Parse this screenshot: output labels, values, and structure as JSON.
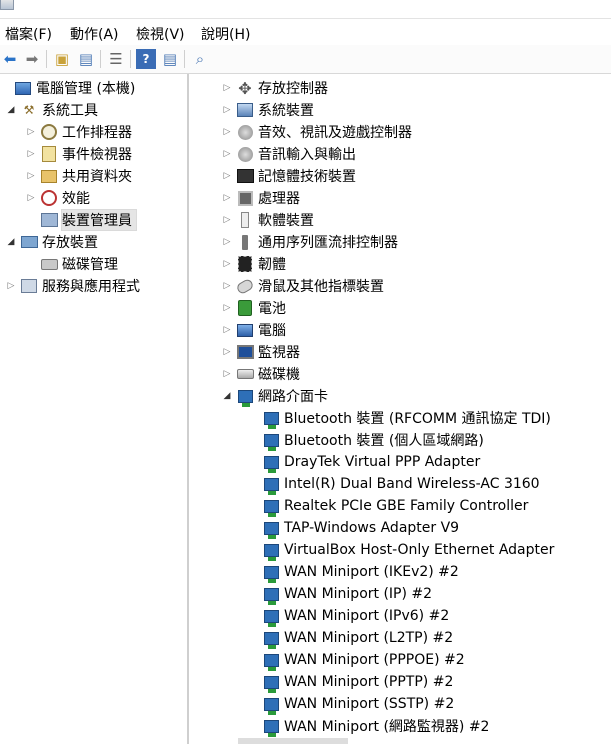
{
  "menu": [
    "檔案(F)",
    "動作(A)",
    "檢視(V)",
    "說明(H)"
  ],
  "toolbar": [
    "back-icon",
    "forward-icon",
    "up-folder-icon",
    "show-hide-tree-icon",
    "export-list-icon",
    "help-icon",
    "properties-icon",
    "scan-hardware-icon"
  ],
  "left_tree": [
    {
      "label": "電腦管理 (本機)",
      "icon": "computer-management-icon",
      "indent": 0,
      "arrow": ""
    },
    {
      "label": "系統工具",
      "icon": "system-tools-icon",
      "indent": 1,
      "arrow": "open"
    },
    {
      "label": "工作排程器",
      "icon": "task-scheduler-icon",
      "indent": 2,
      "arrow": "closed"
    },
    {
      "label": "事件檢視器",
      "icon": "event-viewer-icon",
      "indent": 2,
      "arrow": "closed"
    },
    {
      "label": "共用資料夾",
      "icon": "shared-folders-icon",
      "indent": 2,
      "arrow": "closed"
    },
    {
      "label": "效能",
      "icon": "performance-icon",
      "indent": 2,
      "arrow": "closed"
    },
    {
      "label": "裝置管理員",
      "icon": "device-manager-icon",
      "indent": 2,
      "arrow": "",
      "selected": true
    },
    {
      "label": "存放裝置",
      "icon": "storage-icon",
      "indent": 1,
      "arrow": "open"
    },
    {
      "label": "磁碟管理",
      "icon": "disk-management-icon",
      "indent": 2,
      "arrow": ""
    },
    {
      "label": "服務與應用程式",
      "icon": "services-applications-icon",
      "indent": 1,
      "arrow": "closed"
    }
  ],
  "device_categories": [
    {
      "label": "存放控制器",
      "icon": "storage-controller-icon",
      "arrow": "closed"
    },
    {
      "label": "系統裝置",
      "icon": "system-devices-icon",
      "arrow": "closed"
    },
    {
      "label": "音效、視訊及遊戲控制器",
      "icon": "sound-video-icon",
      "arrow": "closed"
    },
    {
      "label": "音訊輸入與輸出",
      "icon": "audio-io-icon",
      "arrow": "closed"
    },
    {
      "label": "記憶體技術裝置",
      "icon": "memory-device-icon",
      "arrow": "closed"
    },
    {
      "label": "處理器",
      "icon": "processor-icon",
      "arrow": "closed"
    },
    {
      "label": "軟體裝置",
      "icon": "software-device-icon",
      "arrow": "closed"
    },
    {
      "label": "通用序列匯流排控制器",
      "icon": "usb-controller-icon",
      "arrow": "closed"
    },
    {
      "label": "韌體",
      "icon": "firmware-icon",
      "arrow": "closed"
    },
    {
      "label": "滑鼠及其他指標裝置",
      "icon": "mouse-icon",
      "arrow": "closed"
    },
    {
      "label": "電池",
      "icon": "battery-icon",
      "arrow": "closed"
    },
    {
      "label": "電腦",
      "icon": "computer-icon",
      "arrow": "closed"
    },
    {
      "label": "監視器",
      "icon": "monitor-icon",
      "arrow": "closed"
    },
    {
      "label": "磁碟機",
      "icon": "disk-drive-icon",
      "arrow": "closed"
    },
    {
      "label": "網路介面卡",
      "icon": "network-adapter-icon",
      "arrow": "open"
    }
  ],
  "network_adapters": [
    "Bluetooth 裝置 (RFCOMM 通訊協定 TDI)",
    "Bluetooth 裝置 (個人區域網路)",
    "DrayTek Virtual PPP Adapter",
    "Intel(R) Dual Band Wireless-AC 3160",
    "Realtek PCIe GBE Family Controller",
    "TAP-Windows Adapter V9",
    "VirtualBox Host-Only Ethernet Adapter",
    "WAN Miniport (IKEv2) #2",
    "WAN Miniport (IP) #2",
    "WAN Miniport (IPv6) #2",
    "WAN Miniport (L2TP) #2",
    "WAN Miniport (PPPOE) #2",
    "WAN Miniport (PPTP) #2",
    "WAN Miniport (SSTP) #2",
    "WAN Miniport (網路監視器) #2"
  ]
}
